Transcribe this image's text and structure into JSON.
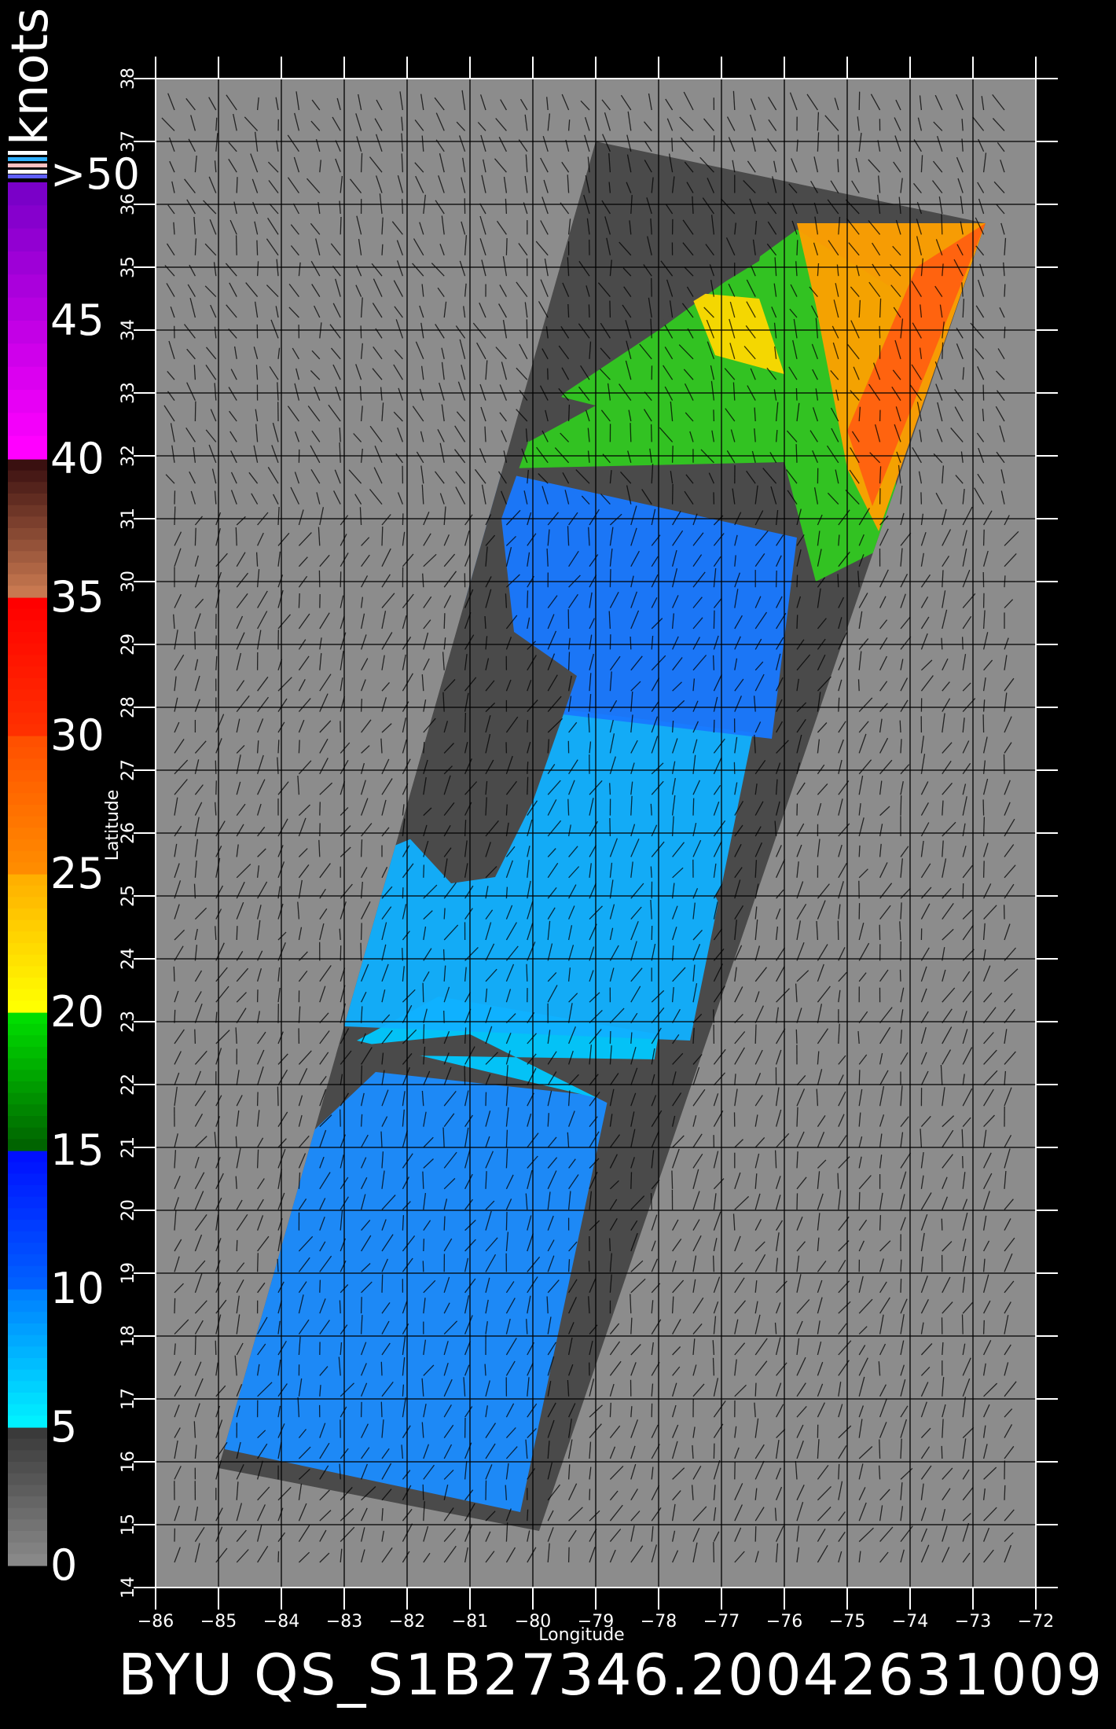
{
  "legend": {
    "units": "knots",
    "ticks": [
      {
        "text": ">50",
        "value": 50
      },
      {
        "text": "45",
        "value": 45
      },
      {
        "text": "40",
        "value": 40
      },
      {
        "text": "35",
        "value": 35
      },
      {
        "text": "30",
        "value": 30
      },
      {
        "text": "25",
        "value": 25
      },
      {
        "text": "20",
        "value": 20
      },
      {
        "text": "15",
        "value": 15
      },
      {
        "text": "10",
        "value": 10
      },
      {
        "text": "5",
        "value": 5
      },
      {
        "text": "0",
        "value": 0
      }
    ],
    "bands": [
      {
        "from": 0,
        "to": 5,
        "colors": [
          "#888888",
          "#3a3a3a"
        ]
      },
      {
        "from": 5,
        "to": 10,
        "colors": [
          "#00f0ff",
          "#0080ff"
        ]
      },
      {
        "from": 10,
        "to": 15,
        "colors": [
          "#0060ff",
          "#0010ff"
        ]
      },
      {
        "from": 15,
        "to": 20,
        "colors": [
          "#006400",
          "#00dd00"
        ]
      },
      {
        "from": 20,
        "to": 25,
        "colors": [
          "#ffff00",
          "#ffb000"
        ]
      },
      {
        "from": 25,
        "to": 30,
        "colors": [
          "#ff8c00",
          "#ff5000"
        ]
      },
      {
        "from": 30,
        "to": 35,
        "colors": [
          "#ff3000",
          "#ff0000"
        ]
      },
      {
        "from": 35,
        "to": 40,
        "colors": [
          "#c87850",
          "#3a1010"
        ]
      },
      {
        "from": 40,
        "to": 50,
        "colors": [
          "#ff00ff",
          "#7a00c8"
        ]
      }
    ]
  },
  "map": {
    "x_title": "Longitude",
    "y_title": "Latitude",
    "lon_range": [
      -86,
      -72
    ],
    "lat_range": [
      14,
      38
    ],
    "lon_ticks": [
      "-86",
      "-85",
      "-84",
      "-83",
      "-82",
      "-81",
      "-80",
      "-79",
      "-78",
      "-77",
      "-76",
      "-75",
      "-74",
      "-73",
      "-72"
    ],
    "lat_ticks": [
      "14",
      "15",
      "16",
      "17",
      "18",
      "19",
      "20",
      "21",
      "22",
      "23",
      "24",
      "25",
      "26",
      "27",
      "28",
      "29",
      "30",
      "31",
      "32",
      "33",
      "34",
      "35",
      "36",
      "37",
      "38"
    ],
    "swath_corners": [
      [
        -79,
        37
      ],
      [
        -72.8,
        35.7
      ],
      [
        -79.9,
        14.9
      ],
      [
        -85,
        15.9
      ]
    ],
    "colors": {
      "background": "#000000",
      "panel": "#8c8c8c",
      "land": "#4a4a4a",
      "grid": "#000000",
      "label": "#ffffff"
    }
  },
  "caption": "BYU  QS_S1B27346.20042631009"
}
